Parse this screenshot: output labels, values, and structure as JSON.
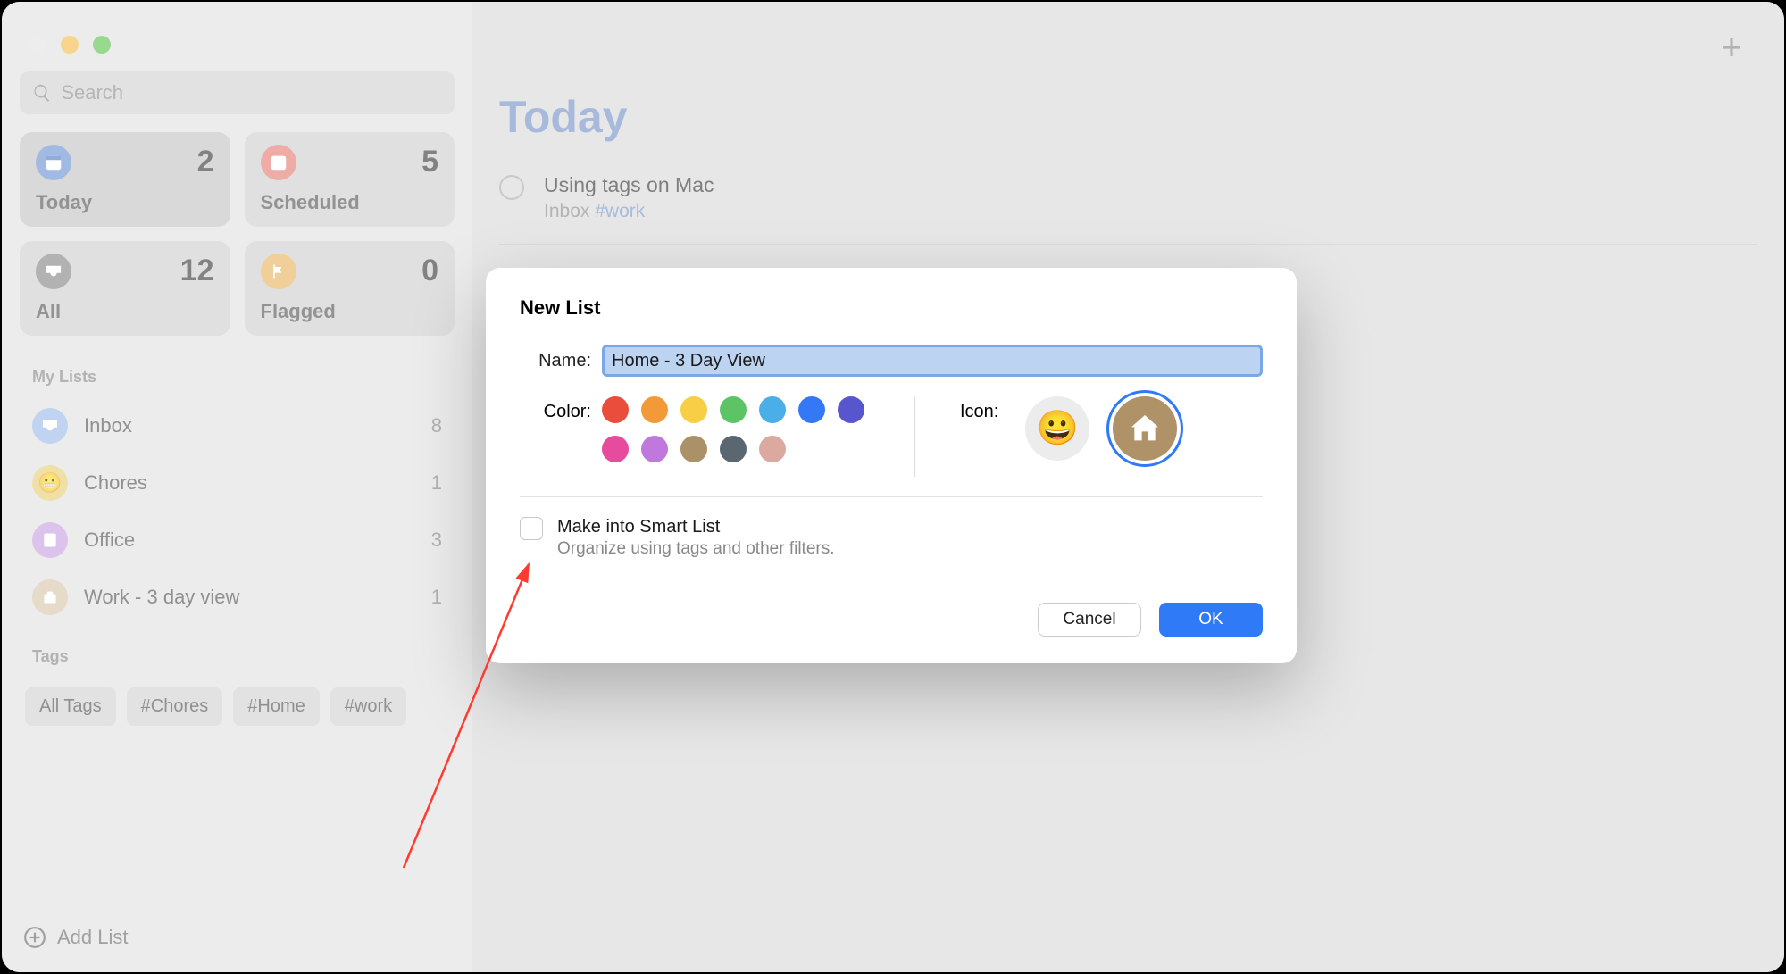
{
  "search": {
    "placeholder": "Search"
  },
  "smart": {
    "today": {
      "label": "Today",
      "count": "2"
    },
    "scheduled": {
      "label": "Scheduled",
      "count": "5"
    },
    "all": {
      "label": "All",
      "count": "12"
    },
    "flagged": {
      "label": "Flagged",
      "count": "0"
    }
  },
  "sections": {
    "mylists": "My Lists",
    "tags": "Tags"
  },
  "lists": {
    "inbox": {
      "label": "Inbox",
      "count": "8"
    },
    "chores": {
      "label": "Chores",
      "count": "1"
    },
    "office": {
      "label": "Office",
      "count": "3"
    },
    "work": {
      "label": "Work - 3 day view",
      "count": "1"
    }
  },
  "tags": {
    "all": "All Tags",
    "chores": "#Chores",
    "home": "#Home",
    "work": "#work"
  },
  "footer": {
    "addlist": "Add List"
  },
  "main": {
    "title": "Today",
    "reminder": {
      "title": "Using tags on Mac",
      "listname": "Inbox",
      "tag": "#work"
    }
  },
  "dialog": {
    "title": "New List",
    "name_label": "Name:",
    "name_value": "Home - 3 Day View",
    "color_label": "Color:",
    "icon_label": "Icon:",
    "colors": {
      "red": "#eb4d3d",
      "orange": "#f19a37",
      "yellow": "#f7ce45",
      "green": "#5dc466",
      "lightblue": "#4aaee8",
      "blue": "#3478f6",
      "indigo": "#5856cf",
      "pink": "#e64b9e",
      "purple": "#c078dc",
      "brown": "#ab9168",
      "gray": "#5b6770",
      "rose": "#dba9a0"
    },
    "smart_title": "Make into Smart List",
    "smart_sub": "Organize using tags and other filters.",
    "cancel": "Cancel",
    "ok": "OK"
  }
}
